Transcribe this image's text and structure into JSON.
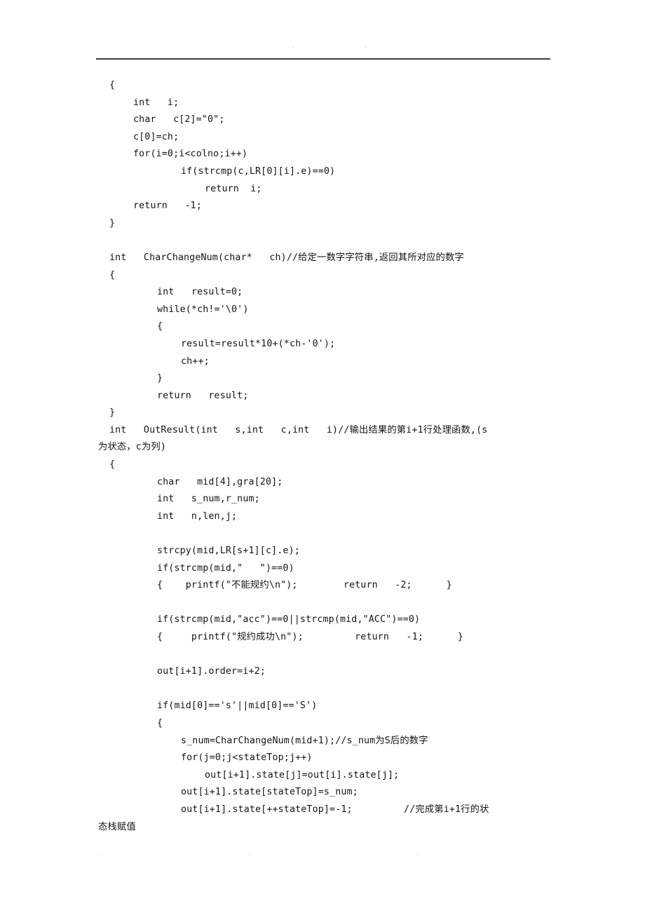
{
  "page": {
    "header": {
      "marks": [
        "·",
        "·"
      ],
      "rule": true
    },
    "footer": {
      "marks": [
        "·",
        "·",
        "·"
      ]
    },
    "code_lines": [
      {
        "indent": 1,
        "text": "{"
      },
      {
        "indent": 2,
        "text": "int   i;"
      },
      {
        "indent": 2,
        "text": "char   c[2]=\"0\";"
      },
      {
        "indent": 2,
        "text": "c[0]=ch;"
      },
      {
        "indent": 2,
        "text": "for(i=0;i<colno;i++)"
      },
      {
        "indent": 4,
        "text": "if(strcmp(c,LR[0][i].e)==0)"
      },
      {
        "indent": 5,
        "text": "return  i;"
      },
      {
        "indent": 2,
        "text": "return   -1;"
      },
      {
        "indent": 1,
        "text": "}"
      },
      {
        "indent": 0,
        "text": ""
      },
      {
        "indent": 1,
        "text": "int   CharChangeNum(char*   ch)//给定一数字字符串,返回其所对应的数字"
      },
      {
        "indent": 1,
        "text": "{"
      },
      {
        "indent": 3,
        "text": "int   result=0;"
      },
      {
        "indent": 3,
        "text": "while(*ch!='\\0')"
      },
      {
        "indent": 3,
        "text": "{"
      },
      {
        "indent": 4,
        "text": "result=result*10+(*ch-'0');"
      },
      {
        "indent": 4,
        "text": "ch++;"
      },
      {
        "indent": 3,
        "text": "}"
      },
      {
        "indent": 3,
        "text": "return   result;"
      },
      {
        "indent": 1,
        "text": "}"
      },
      {
        "indent": 1,
        "text": "int   OutResult(int   s,int   c,int   i)//输出结果的第i+1行处理函数,(s"
      },
      {
        "indent": 0,
        "text": "为状态，c为列)"
      },
      {
        "indent": 1,
        "text": "{"
      },
      {
        "indent": 3,
        "text": "char   mid[4],gra[20];"
      },
      {
        "indent": 3,
        "text": "int   s_num,r_num;"
      },
      {
        "indent": 3,
        "text": "int   n,len,j;"
      },
      {
        "indent": 0,
        "text": ""
      },
      {
        "indent": 3,
        "text": "strcpy(mid,LR[s+1][c].e);"
      },
      {
        "indent": 3,
        "text": "if(strcmp(mid,\"   \")==0)"
      },
      {
        "indent": 3,
        "text": "{    printf(\"不能规约\\n\");        return   -2;      }"
      },
      {
        "indent": 0,
        "text": ""
      },
      {
        "indent": 3,
        "text": "if(strcmp(mid,\"acc\")==0||strcmp(mid,\"ACC\")==0)"
      },
      {
        "indent": 3,
        "text": "{     printf(\"规约成功\\n\");         return   -1;      }"
      },
      {
        "indent": 0,
        "text": ""
      },
      {
        "indent": 3,
        "text": "out[i+1].order=i+2;"
      },
      {
        "indent": 0,
        "text": ""
      },
      {
        "indent": 3,
        "text": "if(mid[0]=='s'||mid[0]=='S')"
      },
      {
        "indent": 3,
        "text": "{"
      },
      {
        "indent": 4,
        "text": "s_num=CharChangeNum(mid+1);//s_num为S后的数字"
      },
      {
        "indent": 4,
        "text": "for(j=0;j<stateTop;j++)"
      },
      {
        "indent": 5,
        "text": "out[i+1].state[j]=out[i].state[j];"
      },
      {
        "indent": 4,
        "text": "out[i+1].state[stateTop]=s_num;"
      },
      {
        "indent": 4,
        "text": "out[i+1].state[++stateTop]=-1;         //完成第i+1行的状"
      },
      {
        "indent": 0,
        "text": "态栈赋值"
      }
    ]
  }
}
